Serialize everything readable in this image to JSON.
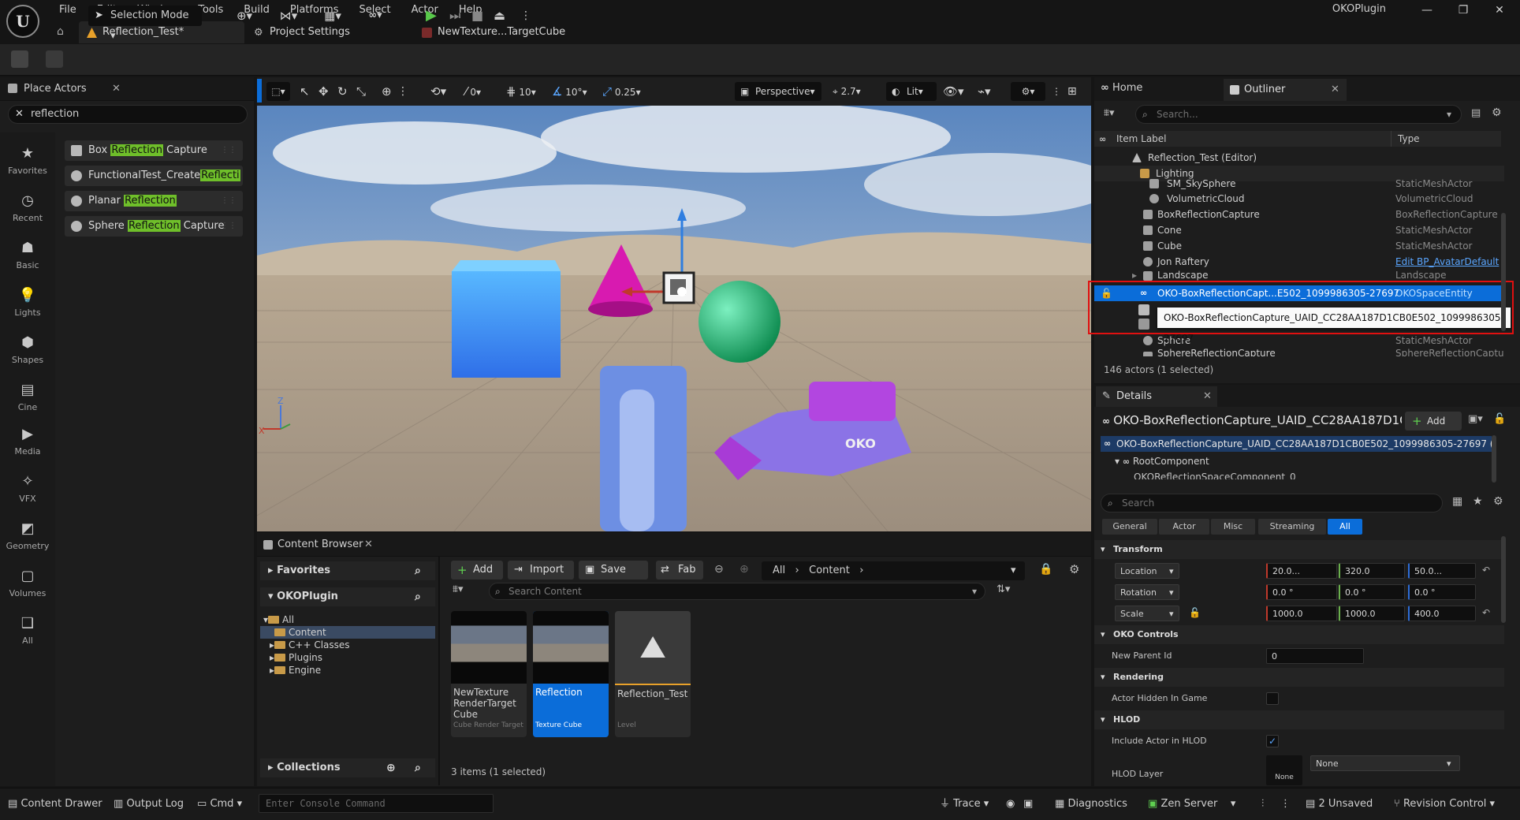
{
  "app": {
    "window_title": "OKOPlugin",
    "menu": [
      "File",
      "Edit",
      "Window",
      "Tools",
      "Build",
      "Platforms",
      "Select",
      "Actor",
      "Help"
    ],
    "doc_tabs": [
      "Reflection_Test*",
      "Project Settings",
      "NewTexture...TargetCube"
    ]
  },
  "toolbar": {
    "selection_mode": "Selection Mode"
  },
  "place_actors": {
    "title": "Place Actors",
    "search_value": "reflection",
    "categories": [
      "Favorites",
      "Recent",
      "Basic",
      "Lights",
      "Shapes",
      "Cine",
      "Media",
      "VFX",
      "Geometry",
      "Volumes",
      "All"
    ],
    "items": [
      {
        "pre": "Box ",
        "hl": "Reflection",
        "post": " Capture"
      },
      {
        "pre": "FunctionalTest_Create",
        "hl": "Reflecti",
        "post": ""
      },
      {
        "pre": "Planar ",
        "hl": "Reflection",
        "post": ""
      },
      {
        "pre": "Sphere ",
        "hl": "Reflection",
        "post": " Capture"
      }
    ]
  },
  "viewport": {
    "move_snap": "0",
    "grid_snap": "10",
    "rotation_snap": "10°",
    "scale_snap": "0.25",
    "view_mode": "Perspective",
    "camera_speed": "2.7",
    "lighting": "Lit",
    "watermark": "OKO"
  },
  "content_browser": {
    "title": "Content Browser",
    "favorites": "Favorites",
    "project": "OKOPlugin",
    "tree": [
      "All",
      "Content",
      "C++ Classes",
      "Plugins",
      "Engine"
    ],
    "collections": "Collections",
    "add": "Add",
    "import": "Import",
    "save_all": "Save All",
    "fab": "Fab",
    "path_all": "All",
    "path_content": "Content",
    "search_placeholder": "Search Content",
    "assets": [
      {
        "name": "NewTexture RenderTarget Cube",
        "type": "Cube Render Target"
      },
      {
        "name": "Reflection",
        "type": "Texture Cube"
      },
      {
        "name": "Reflection_Test",
        "type": "Level"
      }
    ],
    "count": "3 items (1 selected)"
  },
  "outliner": {
    "home_tab": "Home",
    "title": "Outliner",
    "search_placeholder": "Search...",
    "col_label": "Item Label",
    "col_type": "Type",
    "rows": [
      {
        "label": "Reflection_Test (Editor)",
        "type": ""
      },
      {
        "label": "Lighting",
        "type": ""
      },
      {
        "label": "SM_SkySphere",
        "type": "StaticMeshActor"
      },
      {
        "label": "VolumetricCloud",
        "type": "VolumetricCloud"
      },
      {
        "label": "BoxReflectionCapture",
        "type": "BoxReflectionCapture"
      },
      {
        "label": "Cone",
        "type": "StaticMeshActor"
      },
      {
        "label": "Cube",
        "type": "StaticMeshActor"
      },
      {
        "label": "Jon Raftery",
        "type": "Edit BP_AvatarDefault"
      },
      {
        "label": "Landscape",
        "type": "Landscape"
      },
      {
        "label": "OKO-BoxReflectionCapt...E502_1099986305-27697",
        "type": "OKOSpaceEntity"
      },
      {
        "label": "Sphere",
        "type": "StaticMeshActor"
      },
      {
        "label": "SphereReflectionCapture",
        "type": "SphereReflectionCaptu"
      }
    ],
    "tooltip": "OKO-BoxReflectionCapture_UAID_CC28AA187D1CB0E502_1099986305-27697",
    "actors_count": "146 actors (1 selected)"
  },
  "details": {
    "title": "Details",
    "actor_name": "OKO-BoxReflectionCapture_UAID_CC28AA187D1CB",
    "add": "Add",
    "component_root": "OKO-BoxReflectionCapture_UAID_CC28AA187D1CB0E502_1099986305-27697 (Ir",
    "root_component": "RootComponent",
    "sub_component": "OKOReflectionSpaceComponent_0",
    "search_placeholder": "Search",
    "filters": [
      "General",
      "Actor",
      "Misc",
      "Streaming",
      "All"
    ],
    "transform": "Transform",
    "location": {
      "label": "Location",
      "x": "20.0...",
      "y": "320.0",
      "z": "50.0..."
    },
    "rotation": {
      "label": "Rotation",
      "x": "0.0 °",
      "y": "0.0 °",
      "z": "0.0 °"
    },
    "scale": {
      "label": "Scale",
      "x": "1000.0",
      "y": "1000.0",
      "z": "400.0"
    },
    "oko_controls": "OKO Controls",
    "new_parent_label": "New Parent Id",
    "new_parent_value": "0",
    "rendering": "Rendering",
    "hidden_label": "Actor Hidden In Game",
    "hlod": "HLOD",
    "include_hlod_label": "Include Actor in HLOD",
    "hlod_layer_label": "HLOD Layer",
    "hlod_layer_thumb": "None",
    "hlod_layer_value": "None"
  },
  "statusbar": {
    "content_drawer": "Content Drawer",
    "output_log": "Output Log",
    "cmd": "Cmd",
    "console_placeholder": "Enter Console Command",
    "trace": "Trace",
    "diagnostics": "Diagnostics",
    "zen_server": "Zen Server",
    "unsaved": "2 Unsaved",
    "revision_control": "Revision Control"
  },
  "colors": {
    "accent": "#0b6dd9",
    "highlight": "#6fbf2a",
    "callout": "#e01010"
  }
}
